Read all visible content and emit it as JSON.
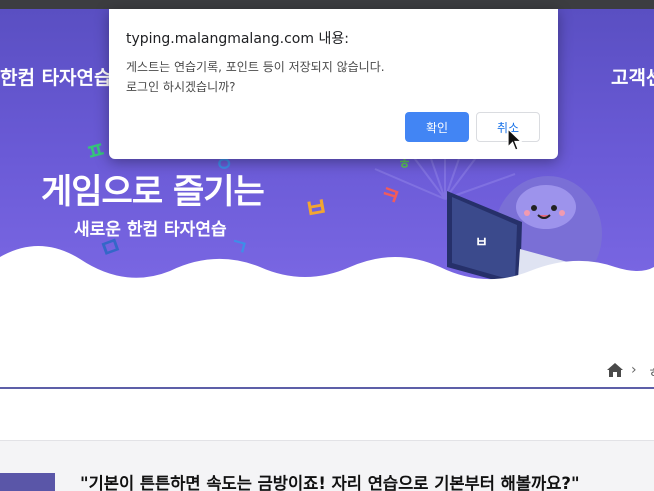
{
  "nav": {
    "left_text": "한컴 타자연습",
    "right_text": "고객센"
  },
  "hero": {
    "headline": "게임으로 즐기는",
    "subheadline": "새로운 한컴 타자연습",
    "laptop_logo": "ㅂ"
  },
  "dialog": {
    "title": "typing.malangmalang.com 내용:",
    "message_line1": "게스트는 연습기록, 포인트 등이 저장되지 않습니다.",
    "message_line2": "로그인 하시겠습니까?",
    "ok_label": "확인",
    "cancel_label": "취소"
  },
  "breadcrumb": {
    "home_icon": "home-icon",
    "separator": "›",
    "current_partial": "ㅎ"
  },
  "content": {
    "quote": "\"기본이 튼튼하면 속도는 금방이죠! 자리 연습으로 기본부터 해볼까요?\""
  },
  "colors": {
    "hero_purple": "#6a5ad6",
    "ok_blue": "#4285f4",
    "divider": "#5d5fa8"
  }
}
